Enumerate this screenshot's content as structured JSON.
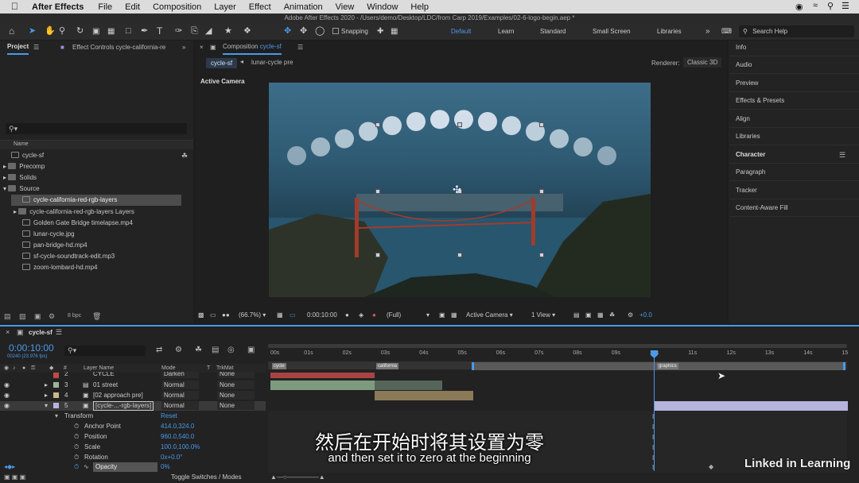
{
  "menubar": {
    "app": "After Effects",
    "items": [
      "File",
      "Edit",
      "Composition",
      "Layer",
      "Effect",
      "Animation",
      "View",
      "Window",
      "Help"
    ]
  },
  "title": "Adobe After Effects 2020 - /Users/demo/Desktop/LDC/from Carp 2019/Examples/02-6-logo-begin.aep *",
  "toolbar": {
    "snapping": "Snapping",
    "workspaces": [
      "Default",
      "Learn",
      "Standard",
      "Small Screen",
      "Libraries"
    ],
    "search": "Search Help"
  },
  "project": {
    "tab": "Project",
    "effect_controls": "Effect Controls cycle-california-re",
    "comp_name": "cycle-sf",
    "column_name": "Name",
    "bpc": "8 bpc",
    "items": [
      "cycle-sf",
      "Precomp",
      "Solids",
      "Source",
      "cycle-california-red-rgb-layers",
      "cycle-california-red-rgb-layers Layers",
      "Golden Gate Bridge timelapse.mp4",
      "lunar-cycle.jpg",
      "pan-bridge-hd.mp4",
      "sf-cycle-soundtrack-edit.mp3",
      "zoom-lombard-hd.mp4"
    ]
  },
  "composition": {
    "tab_prefix": "Composition",
    "tab_name": "cycle-sf",
    "crumb1": "cycle-sf",
    "crumb2": "lunar-cycle pre",
    "renderer_label": "Renderer:",
    "renderer": "Classic 3D",
    "active_camera": "Active Camera",
    "zoom": "(66.7%)",
    "time": "0:00:10:00",
    "resolution": "(Full)",
    "view": "Active Camera",
    "views": "1 View",
    "exposure": "+0.0"
  },
  "right_panels": [
    "Info",
    "Audio",
    "Preview",
    "Effects & Presets",
    "Align",
    "Libraries",
    "Character",
    "Paragraph",
    "Tracker",
    "Content-Aware Fill"
  ],
  "timeline": {
    "tab": "cycle-sf",
    "timecode": "0:00:10:00",
    "frames": "00240 (23.976 fps)",
    "cols": {
      "layer_name": "Layer Name",
      "mode": "Mode",
      "t": "T",
      "trkmat": "TrkMat"
    },
    "ruler": [
      "00s",
      "01s",
      "02s",
      "03s",
      "04s",
      "05s",
      "06s",
      "07s",
      "08s",
      "09s",
      "10s",
      "11s",
      "12s",
      "13s",
      "14s",
      "15"
    ],
    "markers": [
      "cycle",
      "california",
      "graphics"
    ],
    "layers": [
      {
        "num": "2",
        "name": "CYCLE",
        "mode": "Darken",
        "trk": "None"
      },
      {
        "num": "3",
        "name": "01 street",
        "mode": "Normal",
        "trk": "None"
      },
      {
        "num": "4",
        "name": "[02 approach pre]",
        "mode": "Normal",
        "trk": "None"
      },
      {
        "num": "5",
        "name": "[cycle-...-rgb-layers]",
        "mode": "Normal",
        "trk": "None"
      }
    ],
    "transform": "Transform",
    "reset": "Reset",
    "props": [
      {
        "name": "Anchor Point",
        "value": "414.0,324.0"
      },
      {
        "name": "Position",
        "value": "960.0,540.0"
      },
      {
        "name": "Scale",
        "value": "100.0,100.0%"
      },
      {
        "name": "Rotation",
        "value": "0x+0.0°"
      },
      {
        "name": "Opacity",
        "value": "0%"
      }
    ],
    "toggle": "Toggle Switches / Modes"
  },
  "subtitle": {
    "zh": "然后在开始时将其设置为零",
    "en": "and then set it to zero at the beginning"
  },
  "watermark": "Linked in Learning",
  "moons": [
    1,
    2,
    3,
    4,
    5,
    6,
    7,
    8,
    9,
    10,
    11,
    12,
    13,
    14
  ]
}
